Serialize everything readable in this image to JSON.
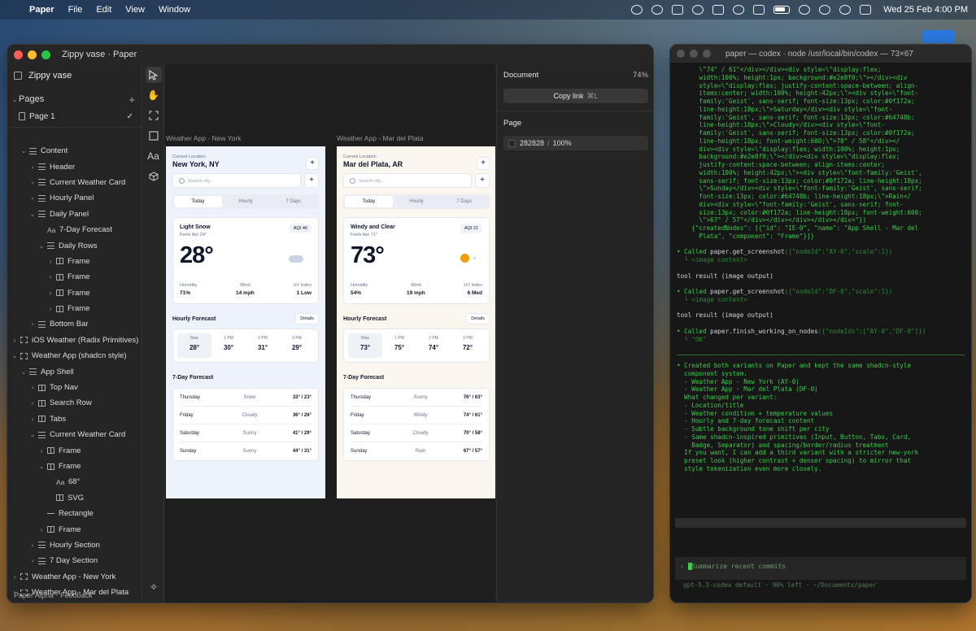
{
  "menubar": {
    "app": "Paper",
    "menus": [
      "File",
      "Edit",
      "View",
      "Window"
    ],
    "clock": "Wed 25 Feb  4:00 PM"
  },
  "paper": {
    "title": "Zippy vase · Paper",
    "project": "Zippy vase",
    "pages_label": "Pages",
    "page1": "Page 1",
    "layers": [
      {
        "label": "Content",
        "depth": 1,
        "icon": "rows-icon",
        "chev": "⌄"
      },
      {
        "label": "Header",
        "depth": 2,
        "icon": "rows-icon",
        "chev": "›"
      },
      {
        "label": "Current Weather Card",
        "depth": 2,
        "icon": "rows-icon",
        "chev": "›"
      },
      {
        "label": "Hourly Panel",
        "depth": 2,
        "icon": "rows-icon",
        "chev": "›"
      },
      {
        "label": "Daily Panel",
        "depth": 2,
        "icon": "rows-icon",
        "chev": "⌄"
      },
      {
        "label": "7-Day Forecast",
        "depth": 3,
        "icon": "text-icon",
        "chev": ""
      },
      {
        "label": "Daily Rows",
        "depth": 3,
        "icon": "rows-icon",
        "chev": "⌄"
      },
      {
        "label": "Frame",
        "depth": 4,
        "icon": "columns-icon",
        "chev": "›"
      },
      {
        "label": "Frame",
        "depth": 4,
        "icon": "columns-icon",
        "chev": "›"
      },
      {
        "label": "Frame",
        "depth": 4,
        "icon": "columns-icon",
        "chev": "›"
      },
      {
        "label": "Frame",
        "depth": 4,
        "icon": "columns-icon",
        "chev": "›"
      },
      {
        "label": "Bottom Bar",
        "depth": 2,
        "icon": "rows-icon",
        "chev": "›"
      },
      {
        "label": "iOS Weather (Radix Primitives)",
        "depth": 0,
        "icon": "frame-icon",
        "chev": "›"
      },
      {
        "label": "Weather App (shadcn style)",
        "depth": 0,
        "icon": "frame-icon",
        "chev": "⌄"
      },
      {
        "label": "App Shell",
        "depth": 1,
        "icon": "rows-icon",
        "chev": "⌄"
      },
      {
        "label": "Top Nav",
        "depth": 2,
        "icon": "columns-icon",
        "chev": "›"
      },
      {
        "label": "Search Row",
        "depth": 2,
        "icon": "columns-icon",
        "chev": "›"
      },
      {
        "label": "Tabs",
        "depth": 2,
        "icon": "columns-icon",
        "chev": "›"
      },
      {
        "label": "Current Weather Card",
        "depth": 2,
        "icon": "rows-icon",
        "chev": "⌄"
      },
      {
        "label": "Frame",
        "depth": 3,
        "icon": "columns-icon",
        "chev": "›"
      },
      {
        "label": "Frame",
        "depth": 3,
        "icon": "columns-icon",
        "chev": "⌄"
      },
      {
        "label": "68°",
        "depth": 4,
        "icon": "text-icon",
        "chev": ""
      },
      {
        "label": "SVG",
        "depth": 4,
        "icon": "columns-icon",
        "chev": ""
      },
      {
        "label": "Rectangle",
        "depth": 3,
        "icon": "line-icon",
        "chev": ""
      },
      {
        "label": "Frame",
        "depth": 3,
        "icon": "columns-icon",
        "chev": "›"
      },
      {
        "label": "Hourly Section",
        "depth": 2,
        "icon": "rows-icon",
        "chev": "›"
      },
      {
        "label": "7 Day Section",
        "depth": 2,
        "icon": "rows-icon",
        "chev": "›"
      },
      {
        "label": "Weather App - New York",
        "depth": 0,
        "icon": "frame-icon",
        "chev": "›"
      },
      {
        "label": "Weather App - Mar del Plata",
        "depth": 0,
        "icon": "frame-icon",
        "chev": "›"
      }
    ],
    "footer": "Paper Alpha  ·  Feedback",
    "props": {
      "document": "Document",
      "zoom": "74%",
      "copy_link": "Copy link",
      "copy_kbd": "⌘L",
      "page": "Page",
      "fill_hex": "282828",
      "fill_opacity": "100%"
    },
    "artboards": [
      {
        "label": "Weather App - New York",
        "loc_small": "Current Location",
        "loc": "New York, NY",
        "search": "Search city...",
        "tabs": [
          "Today",
          "Hourly",
          "7 Days"
        ],
        "condition": "Light Snow",
        "feels": "Feels like 24°",
        "aqi": "AQI 46",
        "temp": "28°",
        "icon": "cloud-icon",
        "metrics": [
          {
            "k": "Humidity",
            "v": "71%"
          },
          {
            "k": "Wind",
            "v": "14 mph"
          },
          {
            "k": "UV Index",
            "v": "1 Low"
          }
        ],
        "hourly_title": "Hourly Forecast",
        "details": "Details",
        "hourly": [
          {
            "t": "Now",
            "v": "28°"
          },
          {
            "t": "1 PM",
            "v": "30°"
          },
          {
            "t": "2 PM",
            "v": "31°"
          },
          {
            "t": "3 PM",
            "v": "29°"
          }
        ],
        "week_title": "7-Day Forecast",
        "week": [
          {
            "d": "Thursday",
            "c": "Snow",
            "r": "33° / 23°"
          },
          {
            "d": "Friday",
            "c": "Cloudy",
            "r": "36° / 26°"
          },
          {
            "d": "Saturday",
            "c": "Sunny",
            "r": "41° / 29°"
          },
          {
            "d": "Sunday",
            "c": "Sunny",
            "r": "44° / 31°"
          }
        ]
      },
      {
        "label": "Weather App - Mar del Plata",
        "loc_small": "Current Location",
        "loc": "Mar del Plata, AR",
        "search": "Search city...",
        "tabs": [
          "Today",
          "Hourly",
          "7 Days"
        ],
        "condition": "Windy and Clear",
        "feels": "Feels like 71°",
        "aqi": "AQI 21",
        "temp": "73°",
        "icon": "sun-icon",
        "metrics": [
          {
            "k": "Humidity",
            "v": "54%"
          },
          {
            "k": "Wind",
            "v": "19 mph"
          },
          {
            "k": "UV Index",
            "v": "6 Med"
          }
        ],
        "hourly_title": "Hourly Forecast",
        "details": "Details",
        "hourly": [
          {
            "t": "Now",
            "v": "73°"
          },
          {
            "t": "1 PM",
            "v": "75°"
          },
          {
            "t": "2 PM",
            "v": "74°"
          },
          {
            "t": "3 PM",
            "v": "72°"
          }
        ],
        "week_title": "7-Day Forecast",
        "week": [
          {
            "d": "Thursday",
            "c": "Sunny",
            "r": "76° / 63°"
          },
          {
            "d": "Friday",
            "c": "Windy",
            "r": "74° / 61°"
          },
          {
            "d": "Saturday",
            "c": "Cloudy",
            "r": "70° / 58°"
          },
          {
            "d": "Sunday",
            "c": "Rain",
            "r": "67° / 57°"
          }
        ]
      }
    ]
  },
  "terminal": {
    "title": "paper — codex · node /usr/local/bin/codex — 73×67",
    "log_lines": [
      "      \\\"74° / 61°</div></div><div style=\\\"display:flex;",
      "      width:100%; height:1px; background:#e2e8f0;\\\"></div><div",
      "      style=\\\"display:flex; justify-content:space-between; align-",
      "      items:center; width:100%; height:42px;\\\"><div style=\\\"font-",
      "      family:'Geist', sans-serif; font-size:13px; color:#0f172a;",
      "      line-height:18px;\\\">Saturday</div><div style=\\\"font-",
      "      family:'Geist', sans-serif; font-size:13px; color:#64748b;",
      "      line-height:18px;\\\">Cloudy</div><div style=\\\"font-",
      "      family:'Geist', sans-serif; font-size:13px; color:#0f172a;",
      "      line-height:18px; font-weight:600;\\\">70° / 58°</div></",
      "      div><div style=\\\"display:flex; width:100%; height:1px;",
      "      background:#e2e8f0;\\\"></div><div style=\\\"display:flex;",
      "      justify-content:space-between; align-items:center;",
      "      width:100%; height:42px;\\\"><div style=\\\"font-family:'Geist',",
      "      sans-serif; font-size:13px; color:#0f172a; line-height:18px;",
      "      \\\">Sunday</div><div style=\\\"font-family:'Geist', sans-serif;",
      "      font-size:13px; color:#64748b; line-height:18px;\\\">Rain</",
      "      div><div style=\\\"font-family:'Geist', sans-serif; font-",
      "      size:13px; color:#0f172a; line-height:18px; font-weight:600;",
      "      \\\">67° / 57°</div></div></div></div></div>\"})",
      "    {\"createdNodes\": [{\"id\": \"IE-0\", \"name\": \"App Shell - Mar del",
      "      Plata\", \"component\": \"Frame\"}]}"
    ],
    "calls": [
      {
        "label": "• Called",
        "fn": "paper.get_screenshot",
        "args": "({\"nodeId\":\"AY-0\",\"scale\":1})",
        "sub": "  └ <image content>",
        "result": "tool result (image output)"
      },
      {
        "label": "• Called",
        "fn": "paper.get_screenshot",
        "args": "({\"nodeId\":\"DF-0\",\"scale\":1})",
        "sub": "  └ <image content>",
        "result": "tool result (image output)"
      },
      {
        "label": "• Called",
        "fn": "paper.finish_working_on_nodes",
        "args": "({\"nodeIds\":[\"AY-0\",\"DF-0\"]})",
        "sub": "  └ \"OK\"",
        "result": ""
      }
    ],
    "summary_lines": [
      "• Created both variants on Paper and kept the same shadcn-style",
      "  component system.",
      "",
      "  - Weather App - New York (AY-0)",
      "  - Weather App - Mar del Plata (DF-0)",
      "",
      "  What changed per variant:",
      "",
      "  - Location/title",
      "  - Weather condition + temperature values",
      "  - Hourly and 7-day forecast content",
      "  - Subtle background tone shift per city",
      "  - Same shadcn-inspired primitives (Input, Button, Tabs, Card,",
      "    Badge, Separator) and spacing/border/radius treatment",
      "",
      "  If you want, I can add a third variant with a stricter new-york",
      "  preset look (higher contrast + denser spacing) to mirror that",
      "  style tokenization even more closely."
    ],
    "prompt_placeholder": "Summarize recent commits",
    "status": "gpt-5.3-codex default · 90% left · ~/Documents/paper"
  }
}
